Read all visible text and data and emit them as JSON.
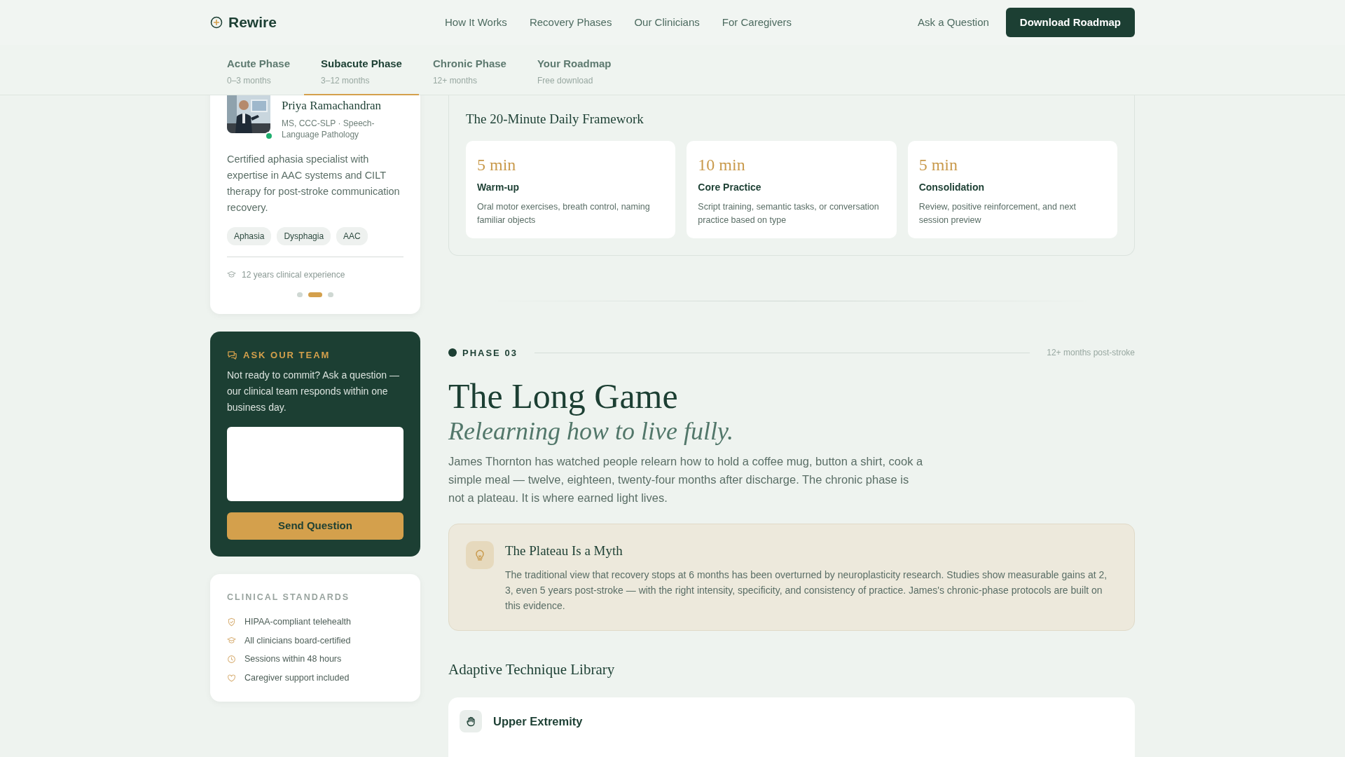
{
  "brand": {
    "name": "Rewire"
  },
  "nav": [
    "How It Works",
    "Recovery Phases",
    "Our Clinicians",
    "For Caregivers"
  ],
  "header_actions": {
    "link": "Ask a Question",
    "button": "Download Roadmap"
  },
  "phase_tabs": [
    {
      "label": "Acute Phase",
      "sub": "0–3 months",
      "selected": false
    },
    {
      "label": "Subacute Phase",
      "sub": "3–12 months",
      "selected": true
    },
    {
      "label": "Chronic Phase",
      "sub": "12+ months",
      "selected": false
    },
    {
      "label": "Your Roadmap",
      "sub": "Free download",
      "selected": false
    }
  ],
  "clinician_card": {
    "name": "Priya Ramachandran",
    "credentials": "MS, CCC-SLP · Speech-Language Pathology",
    "online": true,
    "bio": "Certified aphasia specialist with expertise in AAC systems and CILT therapy for post-stroke communication recovery.",
    "tags": [
      "Aphasia",
      "Dysphagia",
      "AAC"
    ],
    "experience": "12 years clinical experience",
    "carousel_dots": [
      {
        "selected": false
      },
      {
        "selected": true
      },
      {
        "selected": false
      }
    ]
  },
  "ask_card": {
    "title": "ASK OUR TEAM",
    "text": "Not ready to commit? Ask a question — our clinical team responds within one business day.",
    "button": "Send Question"
  },
  "standards": {
    "title": "CLINICAL STANDARDS",
    "items": [
      {
        "kind": "shield",
        "text": "HIPAA-compliant telehealth"
      },
      {
        "kind": "cap",
        "text": "All clinicians board-certified"
      },
      {
        "kind": "clock",
        "text": "Sessions within 48 hours"
      },
      {
        "kind": "heart",
        "text": "Caregiver support included"
      }
    ]
  },
  "framework": {
    "title": "The 20-Minute Daily Framework",
    "steps": [
      {
        "duration": "5 min",
        "title": "Warm-up",
        "text": "Oral motor exercises, breath control, naming familiar objects"
      },
      {
        "duration": "10 min",
        "title": "Core Practice",
        "text": "Script training, semantic tasks, or conversation practice based on type"
      },
      {
        "duration": "5 min",
        "title": "Consolidation",
        "text": "Review, positive reinforcement, and next session preview"
      }
    ]
  },
  "phase": {
    "label": "PHASE 03",
    "timing": "12+ months post-stroke",
    "title": "The Long Game",
    "subtitle": "Relearning how to live fully.",
    "intro": "James Thornton has watched people relearn how to hold a coffee mug, button a shirt, cook a simple meal — twelve, eighteen, twenty-four months after discharge. The chronic phase is not a plateau. It is where earned light lives.",
    "callout": {
      "title": "The Plateau Is a Myth",
      "text": "The traditional view that recovery stops at 6 months has been overturned by neuroplasticity research. Studies show measurable gains at 2, 3, even 5 years post-stroke — with the right intensity, specificity, and consistency of practice. James's chronic-phase protocols are built on this evidence."
    },
    "library_title": "Adaptive Technique Library",
    "library_items": [
      {
        "title": "Upper Extremity"
      }
    ]
  }
}
